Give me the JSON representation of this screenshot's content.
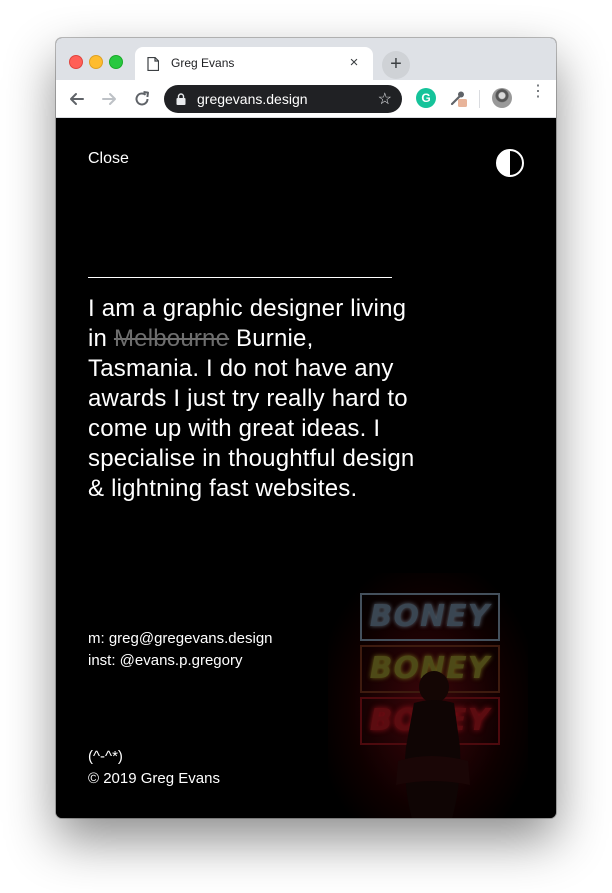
{
  "browser": {
    "tab_title": "Greg Evans",
    "tab_close": "×",
    "new_tab": "+",
    "url": "gregevans.design",
    "bookmark_star": "☆",
    "extension_grammarly": "G",
    "menu_dots": "⋮"
  },
  "page": {
    "close_label": "Close",
    "bio": {
      "part1": "I am a graphic designer living in ",
      "struck": "Melbourne",
      "part2": " Burnie, Tasmania. I do not have any awards I just try really hard to come up with great ideas. I specialise in thoughtful design & lightning fast websites."
    },
    "contact": {
      "email_line": "m: greg@gregevans.design",
      "instagram_line": "inst: @evans.p.gregory"
    },
    "footer": {
      "emoticon": "(^-^*)",
      "copyright": "© 2019 Greg Evans"
    },
    "photo": {
      "signs": [
        "BONEY",
        "BONEY",
        "BONEY"
      ]
    }
  },
  "colors": {
    "page_bg": "#000000",
    "text": "#ffffff",
    "strike_text": "#6e6e6e",
    "omnibox_bg": "#202124",
    "tabbar_bg": "#dee1e6",
    "neon_top": "#7f8fa0",
    "neon_mid": "#b8b04a",
    "neon_low": "#c21d24"
  }
}
